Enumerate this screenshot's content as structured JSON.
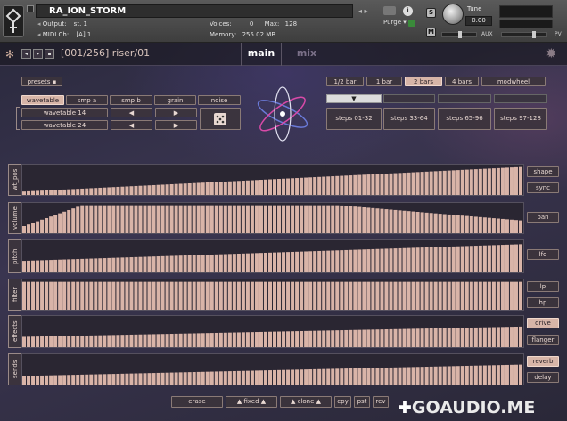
{
  "host": {
    "instrument_name": "RA_ION_STORM",
    "output_label": "Output:",
    "output_value": "st. 1",
    "midi_label": "MIDI Ch:",
    "midi_value": "[A]  1",
    "voices_label": "Voices:",
    "voices_value": "0",
    "max_label": "Max:",
    "max_value": "128",
    "memory_label": "Memory:",
    "memory_value": "255.02 MB",
    "purge_label": "Purge",
    "tune_label": "Tune",
    "tune_value": "0.00",
    "solo_label": "S",
    "mute_label": "M",
    "aux_label": "AUX",
    "pv_label": "PV"
  },
  "plugin": {
    "preset_counter": "[001/256]",
    "preset_name": "riser/01",
    "tab_main": "main",
    "tab_mix": "mix"
  },
  "controls": {
    "presets_label": "presets",
    "source_tabs": [
      "wavetable",
      "smp a",
      "smp b",
      "grain",
      "noise"
    ],
    "wavetable_a": "wavetable  14",
    "wavetable_b": "wavetable  24",
    "length_buttons": [
      "1/2 bar",
      "1 bar",
      "2 bars",
      "4 bars",
      "modwheel"
    ],
    "active_length": "2 bars",
    "step_pages": [
      "steps  01-32",
      "steps  33-64",
      "steps  65-96",
      "steps  97-128"
    ]
  },
  "lanes": [
    {
      "label": "wt_pos",
      "buttons": [
        "shape",
        "sync"
      ],
      "shape": "ramp_up"
    },
    {
      "label": "volume",
      "buttons": [
        "pan"
      ],
      "shape": "plateau"
    },
    {
      "label": "pitch",
      "buttons": [
        "lfo"
      ],
      "shape": "ramp_slow"
    },
    {
      "label": "filter",
      "buttons": [
        "lp",
        "hp"
      ],
      "shape": "flat_full"
    },
    {
      "label": "effects",
      "buttons": [
        "drive",
        "flanger"
      ],
      "active": "drive",
      "shape": "ramp_gentle"
    },
    {
      "label": "sends",
      "buttons": [
        "reverb",
        "delay"
      ],
      "active": "reverb",
      "shape": "ramp_gentle2"
    }
  ],
  "footer": {
    "erase": "erase",
    "fixed": "fixed",
    "clone": "clone",
    "cpy": "cpy",
    "pst": "pst",
    "rev": "rev",
    "arrow_up": "▲"
  },
  "watermark": "GOAUDIO.ME",
  "colors": {
    "bar": "#d9b4a8",
    "accent": "#e8cfc4",
    "lane_bg": "#2a2632"
  }
}
